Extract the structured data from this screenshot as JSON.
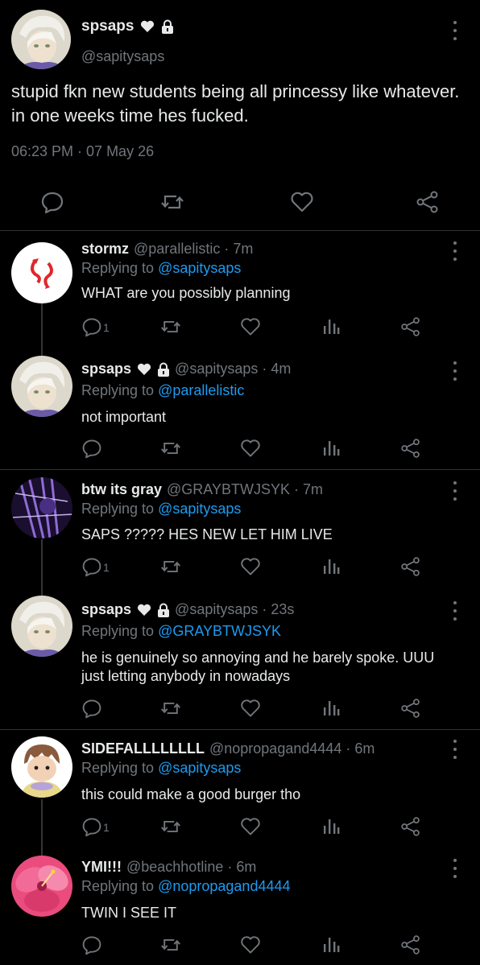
{
  "main_tweet": {
    "display_name": "spsaps",
    "handle": "@sapitysaps",
    "text": "stupid fkn new students being all princessy like whatever. in one weeks time hes fucked.",
    "timestamp": "06:23 PM · 07 May 26",
    "badges": [
      "heart-icon",
      "lock-icon"
    ]
  },
  "replies": [
    {
      "display_name": "stormz",
      "meta": "@parallelistic · 7m",
      "replying_prefix": "Replying to",
      "replying_to": "@sapitysaps",
      "text": "WHAT are you possibly planning",
      "reply_count": "1"
    },
    {
      "display_name": "spsaps",
      "meta": "@sapitysaps · 4m",
      "replying_prefix": "Replying to",
      "replying_to": "@parallelistic",
      "text": "not important",
      "reply_count": ""
    },
    {
      "display_name": "btw its gray",
      "meta": "@GRAYBTWJSYK · 7m",
      "replying_prefix": "Replying to",
      "replying_to": "@sapitysaps",
      "text": "SAPS ????? HES NEW LET HIM LIVE",
      "reply_count": "1"
    },
    {
      "display_name": "spsaps",
      "meta": "@sapitysaps · 23s",
      "replying_prefix": "Replying to",
      "replying_to": "@GRAYBTWJSYK",
      "text": "he is genuinely so annoying and he barely spoke. UUU just letting anybody in nowadays",
      "reply_count": ""
    },
    {
      "display_name": "SIDEFALLLLLLLL",
      "meta": "@nopropagand4444 · 6m",
      "replying_prefix": "Replying to",
      "replying_to": "@sapitysaps",
      "text": "this could make a good burger tho",
      "reply_count": "1"
    },
    {
      "display_name": "YMI!!!",
      "meta": "@beachhotline · 6m",
      "replying_prefix": "Replying to",
      "replying_to": "@nopropagand4444",
      "text": "TWIN I SEE IT",
      "reply_count": ""
    }
  ],
  "colors": {
    "background": "#000000",
    "text": "#e7e9ea",
    "muted": "#71767b",
    "link": "#1d9bf0",
    "divider": "#2f3336"
  }
}
